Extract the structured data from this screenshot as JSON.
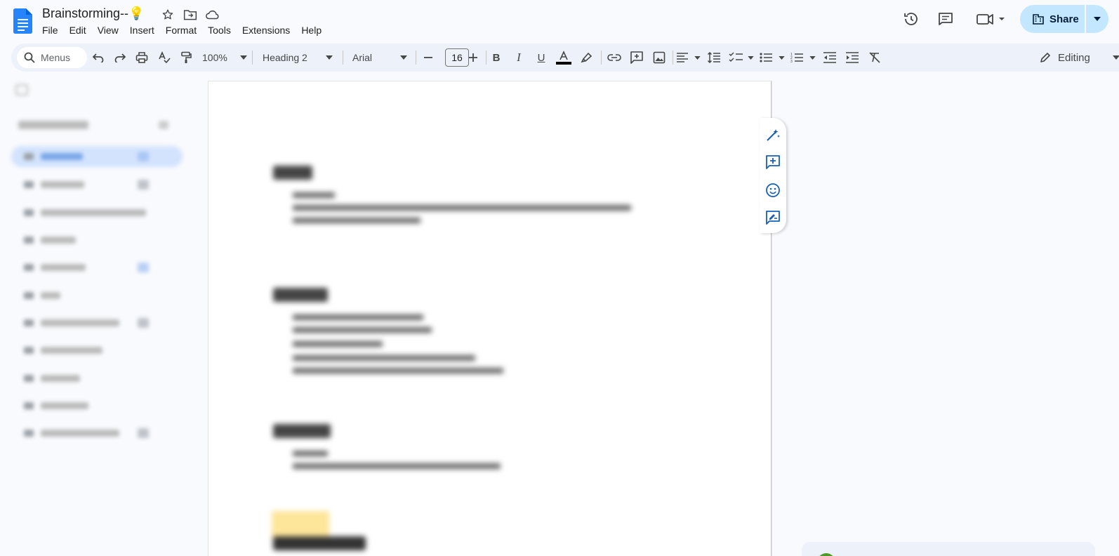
{
  "doc": {
    "title": "Brainstorming--",
    "title_emoji": "💡"
  },
  "menu": [
    "File",
    "Edit",
    "View",
    "Insert",
    "Format",
    "Tools",
    "Extensions",
    "Help"
  ],
  "header_actions": {
    "share_label": "Share"
  },
  "toolbar": {
    "search_placeholder": "Menus",
    "zoom": "100%",
    "style": "Heading 2",
    "font": "Arial",
    "font_size": "16",
    "mode": "Editing"
  },
  "colors": {
    "accent": "#1a73e8",
    "share_bg": "#c2e7ff",
    "toolbar_bg": "#edf2fa",
    "page_bg": "#ffffff",
    "app_bg": "#f8fafd"
  },
  "icons": {
    "doc_logo": "google-docs-icon",
    "star": "star-icon",
    "move": "folder-move-icon",
    "cloud": "cloud-saved-icon",
    "history": "history-icon",
    "comments": "comments-icon",
    "meet": "video-call-icon",
    "share": "building-icon"
  }
}
